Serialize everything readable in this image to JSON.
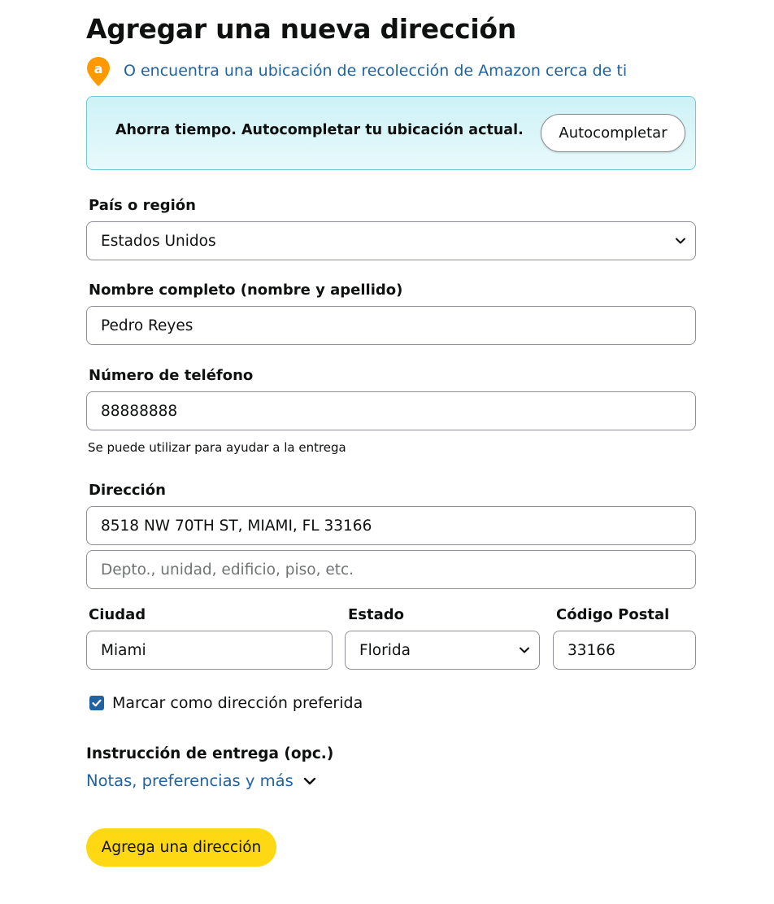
{
  "page": {
    "title": "Agregar una nueva dirección"
  },
  "pickup": {
    "icon": "amazon-location-pin-icon",
    "icon_letter": "a",
    "link_text": "O encuentra una ubicación de recolección de Amazon cerca de ti"
  },
  "autofill": {
    "text": "Ahorra tiempo. Autocompletar tu ubicación actual.",
    "button_label": "Autocompletar"
  },
  "form": {
    "country": {
      "label": "País o región",
      "value": "Estados Unidos"
    },
    "full_name": {
      "label": "Nombre completo (nombre y apellido)",
      "value": "Pedro Reyes"
    },
    "phone": {
      "label": "Número de teléfono",
      "value": "88888888",
      "hint": "Se puede utilizar para ayudar a la entrega"
    },
    "address": {
      "label": "Dirección",
      "line1_value": "8518 NW 70TH ST, MIAMI, FL 33166",
      "line2_placeholder": "Depto., unidad, edificio, piso, etc."
    },
    "city": {
      "label": "Ciudad",
      "value": "Miami"
    },
    "state": {
      "label": "Estado",
      "value": "Florida"
    },
    "zip": {
      "label": "Código Postal",
      "value": "33166"
    },
    "preferred": {
      "label": "Marcar como dirección preferida",
      "checked": true
    },
    "delivery": {
      "label": "Instrucción de entrega (opc.)",
      "link_text": "Notas, preferencias y más"
    },
    "submit_label": "Agrega una dirección"
  },
  "colors": {
    "link": "#2162a1",
    "submit": "#ffd814",
    "autofill_bg": "#cdf2f7",
    "pin": "#ff9900",
    "checkbox": "#2162a1"
  }
}
